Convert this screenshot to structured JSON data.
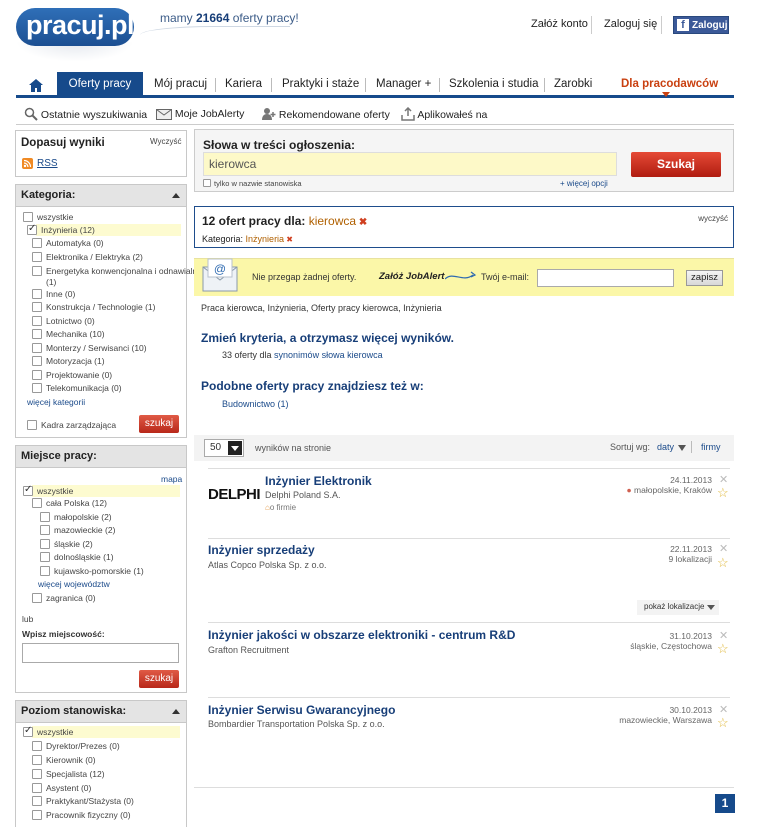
{
  "header": {
    "logo": "pracuj.pl",
    "tagline_pre": "mamy ",
    "tagline_count": "21664",
    "tagline_post": " oferty pracy!",
    "create_account": "Załóż konto",
    "login": "Zaloguj się",
    "fb_login": "Zaloguj",
    "fb_f": "f"
  },
  "nav": {
    "tabs": [
      "Oferty pracy",
      "Mój pracuj",
      "Kariera",
      "Praktyki i staże",
      "Manager +",
      "Szkolenia i studia",
      "Zarobki",
      "Dla pracodawców"
    ]
  },
  "subnav": {
    "items": [
      "Ostatnie wyszukiwania",
      "Moje JobAlerty",
      "Rekomendowane oferty",
      "Aplikowałeś na"
    ]
  },
  "sidebar": {
    "dopasuj": "Dopasuj wyniki",
    "wyczysc": "Wyczyść",
    "rss": "RSS",
    "kategoria": {
      "title": "Kategoria:",
      "items": [
        "wszystkie",
        "Inżynieria (12)",
        "Automatyka (0)",
        "Elektronika / Elektryka (2)",
        "Energetyka konwencjonalna i odnawialna",
        "(1)",
        "Inne (0)",
        "Konstrukcja / Technologie (1)",
        "Lotnictwo (0)",
        "Mechanika (10)",
        "Monterzy / Serwisanci (10)",
        "Motoryzacja (1)",
        "Projektowanie (0)",
        "Telekomunikacja (0)"
      ],
      "more": "więcej kategorii",
      "kadra": "Kadra zarządzająca",
      "szukaj": "szukaj"
    },
    "miejsce": {
      "title": "Miejsce pracy:",
      "mapa": "mapa",
      "items": [
        "wszystkie",
        "cała Polska (12)",
        "małopolskie (2)",
        "mazowieckie (2)",
        "śląskie (2)",
        "dolnośląskie (1)",
        "kujawsko-pomorskie (1)"
      ],
      "more": "więcej województw",
      "zagranica": "zagranica (0)",
      "lub": "lub",
      "wpisz": "Wpisz miejscowość:",
      "szukaj": "szukaj"
    },
    "poziom": {
      "title": "Poziom stanowiska:",
      "items": [
        "wszystkie",
        "Dyrektor/Prezes (0)",
        "Kierownik (0)",
        "Specjalista (12)",
        "Asystent (0)",
        "Praktykant/Stażysta (0)",
        "Pracownik fizyczny (0)"
      ]
    }
  },
  "search": {
    "label": "Słowa w treści ogłoszenia:",
    "value": "kierowca",
    "only_title": "tylko w nazwie stanowiska",
    "more_options": "+ więcej opcji",
    "button": "Szukaj"
  },
  "results": {
    "count_text": "12 ofert pracy dla:",
    "keyword": "kierowca",
    "clear": "wyczyść",
    "category_label": "Kategoria:",
    "category_value": "Inżynieria"
  },
  "jobalert": {
    "text": "Nie przegap żadnej oferty.",
    "cta": "Załóż JobAlert",
    "email_label": "Twój e-mail:",
    "save": "zapisz"
  },
  "breadcrumb": "Praca kierowca, Inżynieria, Oferty pracy kierowca, Inżynieria",
  "suggest": {
    "title1": "Zmień kryteria, a otrzymasz więcej wyników.",
    "line1_count": "33",
    "line1_mid": " oferty dla ",
    "line1_link": "synonimów słowa kierowca",
    "title2": "Podobne oferty pracy znajdziesz też w:",
    "line2_link": "Budownictwo (1)"
  },
  "listing": {
    "per_page": "50",
    "per_page_label": "wyników na stronie",
    "sort_label": "Sortuj wg:",
    "sort_date": "daty",
    "sort_company": "firmy"
  },
  "jobs": [
    {
      "title": "Inżynier Elektronik",
      "company": "Delphi Poland S.A.",
      "date": "24.11.2013",
      "location": "małopolskie, Kraków",
      "logo": "DELPHI",
      "about": "o firmie"
    },
    {
      "title": "Inżynier sprzedaży",
      "company": "Atlas Copco Polska Sp. z o.o.",
      "date": "22.11.2013",
      "location": "9 lokalizacji",
      "show_loc": "pokaż lokalizacje"
    },
    {
      "title": "Inżynier jakości w obszarze elektroniki - centrum R&D",
      "company": "Grafton Recruitment",
      "date": "31.10.2013",
      "location": "śląskie, Częstochowa"
    },
    {
      "title": "Inżynier Serwisu Gwarancyjnego",
      "company": "Bombardier Transportation Polska Sp. z o.o.",
      "date": "30.10.2013",
      "location": "mazowieckie, Warszawa"
    }
  ],
  "pagination": {
    "page": "1"
  }
}
